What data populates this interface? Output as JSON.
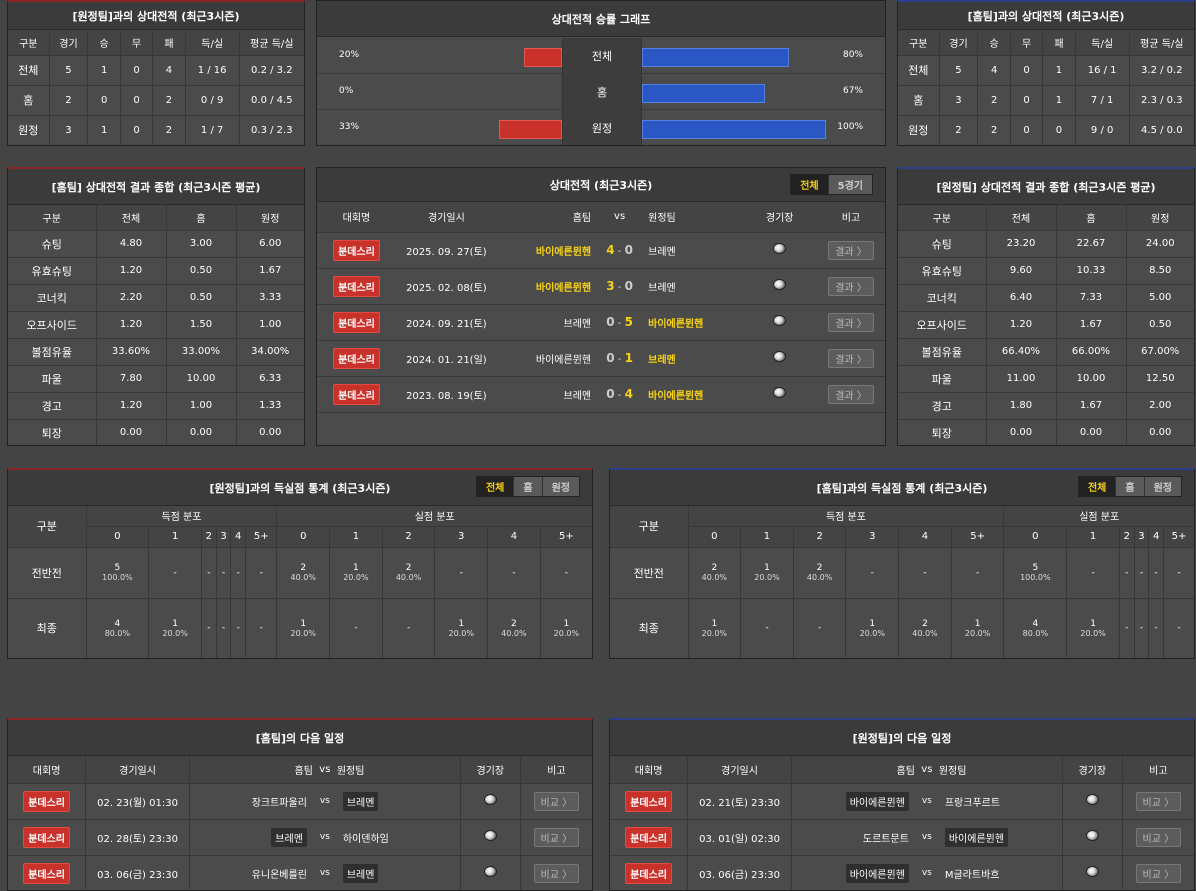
{
  "away_h2h": {
    "title": "[원정팀]과의 상대전적 (최근3시즌)",
    "headers": [
      "구분",
      "경기",
      "승",
      "무",
      "패",
      "득/실",
      "평균 득/실"
    ],
    "rows": [
      [
        "전체",
        "5",
        "1",
        "0",
        "4",
        "1 / 16",
        "0.2 / 3.2"
      ],
      [
        "홈",
        "2",
        "0",
        "0",
        "2",
        "0 / 9",
        "0.0 / 4.5"
      ],
      [
        "원정",
        "3",
        "1",
        "0",
        "2",
        "1 / 7",
        "0.3 / 2.3"
      ]
    ]
  },
  "graph": {
    "title": "상대전적 승률 그래프",
    "rows": [
      {
        "label": "전체",
        "left_text": "20%",
        "right_text": "80%",
        "left": 0.2,
        "right": 0.8
      },
      {
        "label": "홈",
        "left_text": "0%",
        "right_text": "67%",
        "left": 0.0,
        "right": 0.67
      },
      {
        "label": "원정",
        "left_text": "33%",
        "right_text": "100%",
        "left": 0.33,
        "right": 1.0
      }
    ],
    "colors": {
      "left": "#c8322b",
      "right": "#2b57c4"
    }
  },
  "home_h2h": {
    "title": "[홈팀]과의 상대전적 (최근3시즌)",
    "headers": [
      "구분",
      "경기",
      "승",
      "무",
      "패",
      "득/실",
      "평균 득/실"
    ],
    "rows": [
      [
        "전체",
        "5",
        "4",
        "0",
        "1",
        "16 / 1",
        "3.2 / 0.2"
      ],
      [
        "홈",
        "3",
        "2",
        "0",
        "1",
        "7 / 1",
        "2.3 / 0.3"
      ],
      [
        "원정",
        "2",
        "2",
        "0",
        "0",
        "9 / 0",
        "4.5 / 0.0"
      ]
    ]
  },
  "home_stats": {
    "title": "[홈팀] 상대전적 결과 종합 (최근3시즌 평균)",
    "headers": [
      "구분",
      "전체",
      "홈",
      "원정"
    ],
    "rows": [
      [
        "슈팅",
        "4.80",
        "3.00",
        "6.00"
      ],
      [
        "유효슈팅",
        "1.20",
        "0.50",
        "1.67"
      ],
      [
        "코너킥",
        "2.20",
        "0.50",
        "3.33"
      ],
      [
        "오프사이드",
        "1.20",
        "1.50",
        "1.00"
      ],
      [
        "볼점유율",
        "33.60%",
        "33.00%",
        "34.00%"
      ],
      [
        "파울",
        "7.80",
        "10.00",
        "6.33"
      ],
      [
        "경고",
        "1.20",
        "1.00",
        "1.33"
      ],
      [
        "퇴장",
        "0.00",
        "0.00",
        "0.00"
      ]
    ]
  },
  "matches": {
    "title": "상대전적 (최근3시즌)",
    "tabs": [
      "전체",
      "5경기"
    ],
    "headers": [
      "대회명",
      "경기일시",
      "홈팀",
      "vs",
      "원정팀",
      "경기장",
      "비고"
    ],
    "result_label": "결과 〉",
    "rows": [
      {
        "league": "분데스리",
        "date": "2025. 09. 27(토)",
        "home": "바이에른뮌헨",
        "hs": "4",
        "as": "0",
        "away": "브레멘",
        "home_hl": true,
        "away_hl": false
      },
      {
        "league": "분데스리",
        "date": "2025. 02. 08(토)",
        "home": "바이에른뮌헨",
        "hs": "3",
        "as": "0",
        "away": "브레멘",
        "home_hl": true,
        "away_hl": false
      },
      {
        "league": "분데스리",
        "date": "2024. 09. 21(토)",
        "home": "브레멘",
        "hs": "0",
        "as": "5",
        "away": "바이에른뮌헨",
        "home_hl": false,
        "away_hl": true
      },
      {
        "league": "분데스리",
        "date": "2024. 01. 21(일)",
        "home": "바이에른뮌헨",
        "hs": "0",
        "as": "1",
        "away": "브레멘",
        "home_hl": false,
        "away_hl": true
      },
      {
        "league": "분데스리",
        "date": "2023. 08. 19(토)",
        "home": "브레멘",
        "hs": "0",
        "as": "4",
        "away": "바이에른뮌헨",
        "home_hl": false,
        "away_hl": true
      }
    ]
  },
  "away_stats": {
    "title": "[원정팀] 상대전적 결과 종합 (최근3시즌 평균)",
    "headers": [
      "구분",
      "전체",
      "홈",
      "원정"
    ],
    "rows": [
      [
        "슈팅",
        "23.20",
        "22.67",
        "24.00"
      ],
      [
        "유효슈팅",
        "9.60",
        "10.33",
        "8.50"
      ],
      [
        "코너킥",
        "6.40",
        "7.33",
        "5.00"
      ],
      [
        "오프사이드",
        "1.20",
        "1.67",
        "0.50"
      ],
      [
        "볼점유율",
        "66.40%",
        "66.00%",
        "67.00%"
      ],
      [
        "파울",
        "11.00",
        "10.00",
        "12.50"
      ],
      [
        "경고",
        "1.80",
        "1.67",
        "2.00"
      ],
      [
        "퇴장",
        "0.00",
        "0.00",
        "0.00"
      ]
    ]
  },
  "goal_away": {
    "title": "[원정팀]과의 득실점 통계 (최근3시즌)",
    "tabs": [
      "전체",
      "홈",
      "원정"
    ],
    "col_label": "구분",
    "score_label": "득점 분포",
    "concede_label": "실점 분포",
    "buckets": [
      "0",
      "1",
      "2",
      "3",
      "4",
      "5+"
    ],
    "rows": [
      {
        "label": "전반전",
        "cells": [
          [
            "5",
            "100.0%"
          ],
          [
            "-",
            ""
          ],
          [
            "-",
            ""
          ],
          [
            "-",
            ""
          ],
          [
            "-",
            ""
          ],
          [
            "-",
            ""
          ],
          [
            "2",
            "40.0%"
          ],
          [
            "1",
            "20.0%"
          ],
          [
            "2",
            "40.0%"
          ],
          [
            "-",
            ""
          ],
          [
            "-",
            ""
          ],
          [
            "-",
            ""
          ]
        ]
      },
      {
        "label": "최종",
        "cells": [
          [
            "4",
            "80.0%"
          ],
          [
            "1",
            "20.0%"
          ],
          [
            "-",
            ""
          ],
          [
            "-",
            ""
          ],
          [
            "-",
            ""
          ],
          [
            "-",
            ""
          ],
          [
            "1",
            "20.0%"
          ],
          [
            "-",
            ""
          ],
          [
            "-",
            ""
          ],
          [
            "1",
            "20.0%"
          ],
          [
            "2",
            "40.0%"
          ],
          [
            "1",
            "20.0%"
          ]
        ]
      }
    ]
  },
  "goal_home": {
    "title": "[홈팀]과의 득실점 통계 (최근3시즌)",
    "tabs": [
      "전체",
      "홈",
      "원정"
    ],
    "col_label": "구분",
    "score_label": "득점 분포",
    "concede_label": "실점 분포",
    "buckets": [
      "0",
      "1",
      "2",
      "3",
      "4",
      "5+"
    ],
    "rows": [
      {
        "label": "전반전",
        "cells": [
          [
            "2",
            "40.0%"
          ],
          [
            "1",
            "20.0%"
          ],
          [
            "2",
            "40.0%"
          ],
          [
            "-",
            ""
          ],
          [
            "-",
            ""
          ],
          [
            "-",
            ""
          ],
          [
            "5",
            "100.0%"
          ],
          [
            "-",
            ""
          ],
          [
            "-",
            ""
          ],
          [
            "-",
            ""
          ],
          [
            "-",
            ""
          ],
          [
            "-",
            ""
          ]
        ]
      },
      {
        "label": "최종",
        "cells": [
          [
            "1",
            "20.0%"
          ],
          [
            "-",
            ""
          ],
          [
            "-",
            ""
          ],
          [
            "1",
            "20.0%"
          ],
          [
            "2",
            "40.0%"
          ],
          [
            "1",
            "20.0%"
          ],
          [
            "4",
            "80.0%"
          ],
          [
            "1",
            "20.0%"
          ],
          [
            "-",
            ""
          ],
          [
            "-",
            ""
          ],
          [
            "-",
            ""
          ],
          [
            "-",
            ""
          ]
        ]
      }
    ]
  },
  "next_home": {
    "title": "[홈팀]의 다음 일정",
    "headers": [
      "대회명",
      "경기일시",
      "홈팀",
      "vs",
      "원정팀",
      "경기장",
      "비고"
    ],
    "cmp": "비교 〉",
    "rows": [
      {
        "league": "분데스리",
        "date": "02. 23(월) 01:30",
        "home": "장크트파울리",
        "away": "브레멘",
        "hbox": false,
        "abox": true
      },
      {
        "league": "분데스리",
        "date": "02. 28(토) 23:30",
        "home": "브레멘",
        "away": "하이덴하임",
        "hbox": true,
        "abox": false
      },
      {
        "league": "분데스리",
        "date": "03. 06(금) 23:30",
        "home": "유니온베를린",
        "away": "브레멘",
        "hbox": false,
        "abox": true
      }
    ]
  },
  "next_away": {
    "title": "[원정팀]의 다음 일정",
    "headers": [
      "대회명",
      "경기일시",
      "홈팀",
      "vs",
      "원정팀",
      "경기장",
      "비고"
    ],
    "cmp": "비교 〉",
    "rows": [
      {
        "league": "분데스리",
        "date": "02. 21(토) 23:30",
        "home": "바이에른뮌헨",
        "away": "프랑크푸르트",
        "hbox": true,
        "abox": false
      },
      {
        "league": "분데스리",
        "date": "03. 01(일) 02:30",
        "home": "도르트문트",
        "away": "바이에른뮌헨",
        "hbox": false,
        "abox": true
      },
      {
        "league": "분데스리",
        "date": "03. 06(금) 23:30",
        "home": "바이에른뮌헨",
        "away": "M글라트바흐",
        "hbox": true,
        "abox": false
      }
    ]
  }
}
